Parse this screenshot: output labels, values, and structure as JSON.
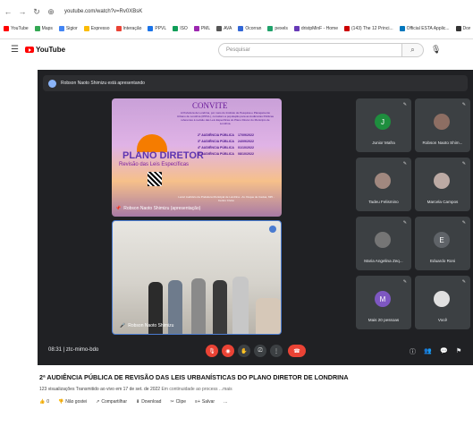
{
  "browser": {
    "url": "youtube.com/watch?v=Rv0XBsK",
    "bookmarks": [
      "YouTube",
      "Maps",
      "Sigior",
      "Expresso",
      "Interação",
      "PPVL",
      "ISO",
      "PML",
      "AVA",
      "Ocorran",
      "pexels",
      "dristpMinF - Home",
      "(143) The 12 Princi...",
      "Official ESTA Applic...",
      "Download"
    ]
  },
  "youtube": {
    "logo": "YouTube",
    "search_placeholder": "Pesquisar"
  },
  "meet": {
    "presenter_banner": "Robson Naoto Shimizu está apresentando",
    "slide": {
      "title": "CONVITE",
      "subtitle": "A Prefeitura de Londrina, por meio do Instituto de Pesquisa e Planejamento Urbano de Londrina (IPPUL), convidam a população para as Audiências Públicas referentes à revisão das Leis Específicas do Plano Diretor do Município de Londrina.",
      "main": "PLANO DIRETOR",
      "main2": "Revisão das Leis Específicas",
      "audiences": [
        {
          "name": "2ª AUDIÊNCIA PÚBLICA",
          "date": "17/09/2022"
        },
        {
          "name": "3ª AUDIÊNCIA PÚBLICA",
          "date": "24/09/2022"
        },
        {
          "name": "4ª AUDIÊNCIA PÚBLICA",
          "date": "01/10/2022"
        },
        {
          "name": "5ª AUDIÊNCIA PÚBLICA",
          "date": "08/10/2022"
        }
      ],
      "footer": "Local: Auditório da Prefeitura Municipal de Londrina - Av. Duque de Caxias, 635 - Centro Cívico",
      "name_tag": "Robson Naoto Shimizu (apresentação)"
    },
    "cam_name": "Robson Naoto Shimizu",
    "participants": [
      {
        "name": "Junior Mafra",
        "initial": "J",
        "color": "#1e8e3e"
      },
      {
        "name": "Robson Naoto Shim...",
        "initial": "",
        "color": "#8d6e63"
      },
      {
        "name": "Tadeu Felismino",
        "initial": "",
        "color": "#a1887f"
      },
      {
        "name": "Marcela Campos",
        "initial": "",
        "color": "#bcaaa4"
      },
      {
        "name": "Maria Angelina Zeq...",
        "initial": "",
        "color": "#757575"
      },
      {
        "name": "Eduardo Roni",
        "initial": "E",
        "color": "#5f6368"
      },
      {
        "name": "Mais 20 pessoas",
        "initial": "M",
        "color": "#7e57c2"
      },
      {
        "name": "Você",
        "initial": "",
        "color": "#e0e0e0"
      }
    ],
    "time": "08:31",
    "meeting_code": "ztc-mimo-bdo"
  },
  "video": {
    "title": "2ª AUDIÊNCIA PÚBLICA DE REVISÃO DAS LEIS URBANÍSTICAS DO PLANO DIRETOR DE LONDRINA",
    "meta": "123 visualizações  Transmitido ao vivo em 17 de set. de 2022",
    "meta_more": "Em continuidade ao process ...mais",
    "actions": {
      "like": "0",
      "dislike": "Não gostei",
      "share": "Compartilhar",
      "download": "Download",
      "clip": "Clipe",
      "save": "Salvar",
      "more": "..."
    }
  }
}
